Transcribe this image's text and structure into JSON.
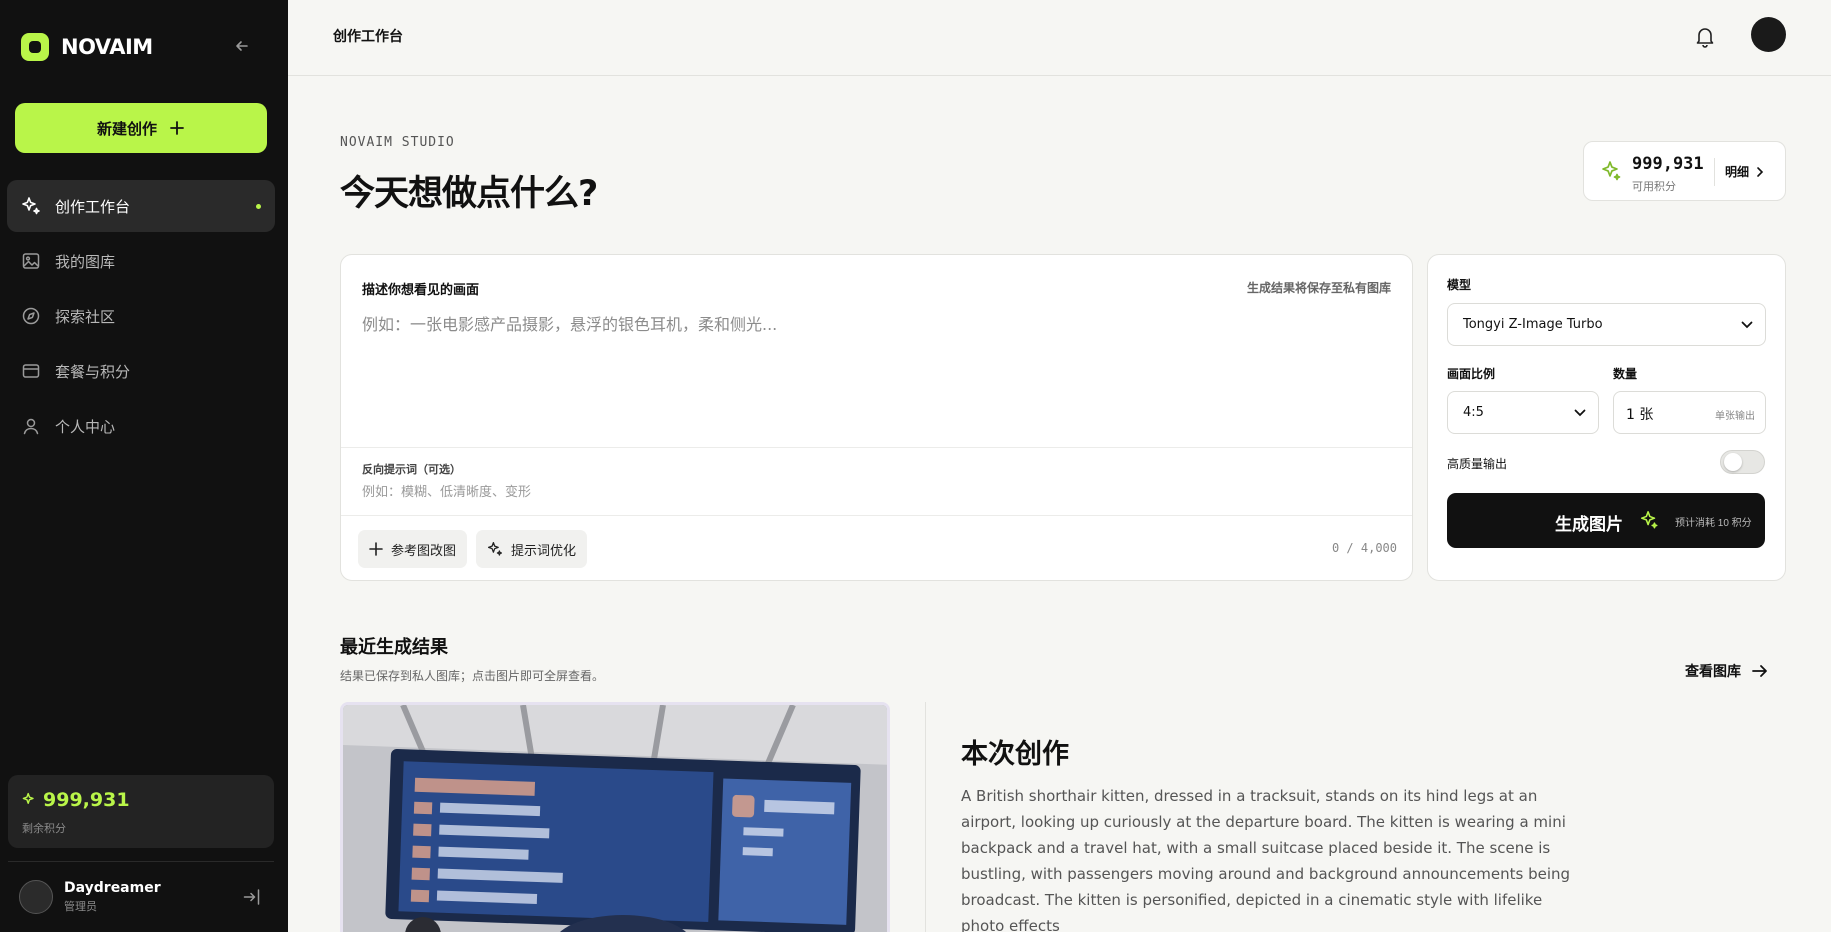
{
  "brand": {
    "name": "NOVAIM"
  },
  "sidebar": {
    "new_label": "新建创作",
    "items": [
      {
        "label": "创作工作台",
        "icon": "sparkle-icon",
        "active": true
      },
      {
        "label": "我的图库",
        "icon": "image-icon"
      },
      {
        "label": "探索社区",
        "icon": "compass-icon"
      },
      {
        "label": "套餐与积分",
        "icon": "card-icon"
      },
      {
        "label": "个人中心",
        "icon": "user-icon"
      }
    ],
    "points": {
      "value": "999,931",
      "label": "剩余积分"
    },
    "user": {
      "name": "Daydreamer",
      "role": "管理员"
    }
  },
  "topbar": {
    "title": "创作工作台"
  },
  "hero": {
    "eyebrow": "NOVAIM STUDIO",
    "headline": "今天想做点什么?",
    "credits": {
      "value": "999,931",
      "label": "可用积分",
      "detail": "明细"
    }
  },
  "prompt": {
    "label": "描述你想看见的画面",
    "note": "生成结果将保存至私有图库",
    "placeholder": "例如：一张电影感产品摄影，悬浮的银色耳机，柔和侧光...",
    "negative_label": "反向提示词（可选）",
    "negative_placeholder": "例如：模糊、低清晰度、变形",
    "ref_button": "参考图改图",
    "optimize_button": "提示词优化",
    "counter": "0 / 4,000"
  },
  "settings": {
    "model_label": "模型",
    "model_value": "Tongyi Z-Image Turbo",
    "ratio_label": "画面比例",
    "ratio_value": "4:5",
    "qty_label": "数量",
    "qty_value": "1 张",
    "qty_hint": "单张输出",
    "hq_label": "高质量输出",
    "hq_enabled": false,
    "generate_label": "生成图片",
    "generate_cost": "预计消耗 10 积分"
  },
  "recent": {
    "title": "最近生成结果",
    "subtitle": "结果已保存到私人图库；点击图片即可全屏查看。",
    "view_all": "查看图库",
    "result_title": "本次创作",
    "result_desc": "A British shorthair kitten, dressed in a tracksuit, stands on its hind legs at an airport, looking up curiously at the departure board. The kitten is wearing a mini backpack and a travel hat, with a small suitcase placed beside it. The scene is bustling, with passengers moving around and background announcements being broadcast. The kitten is personified, depicted in a cinematic style with lifelike photo effects"
  },
  "colors": {
    "accent": "#b9f549",
    "sidebar_bg": "#111111",
    "page_bg": "#f6f6f3"
  }
}
